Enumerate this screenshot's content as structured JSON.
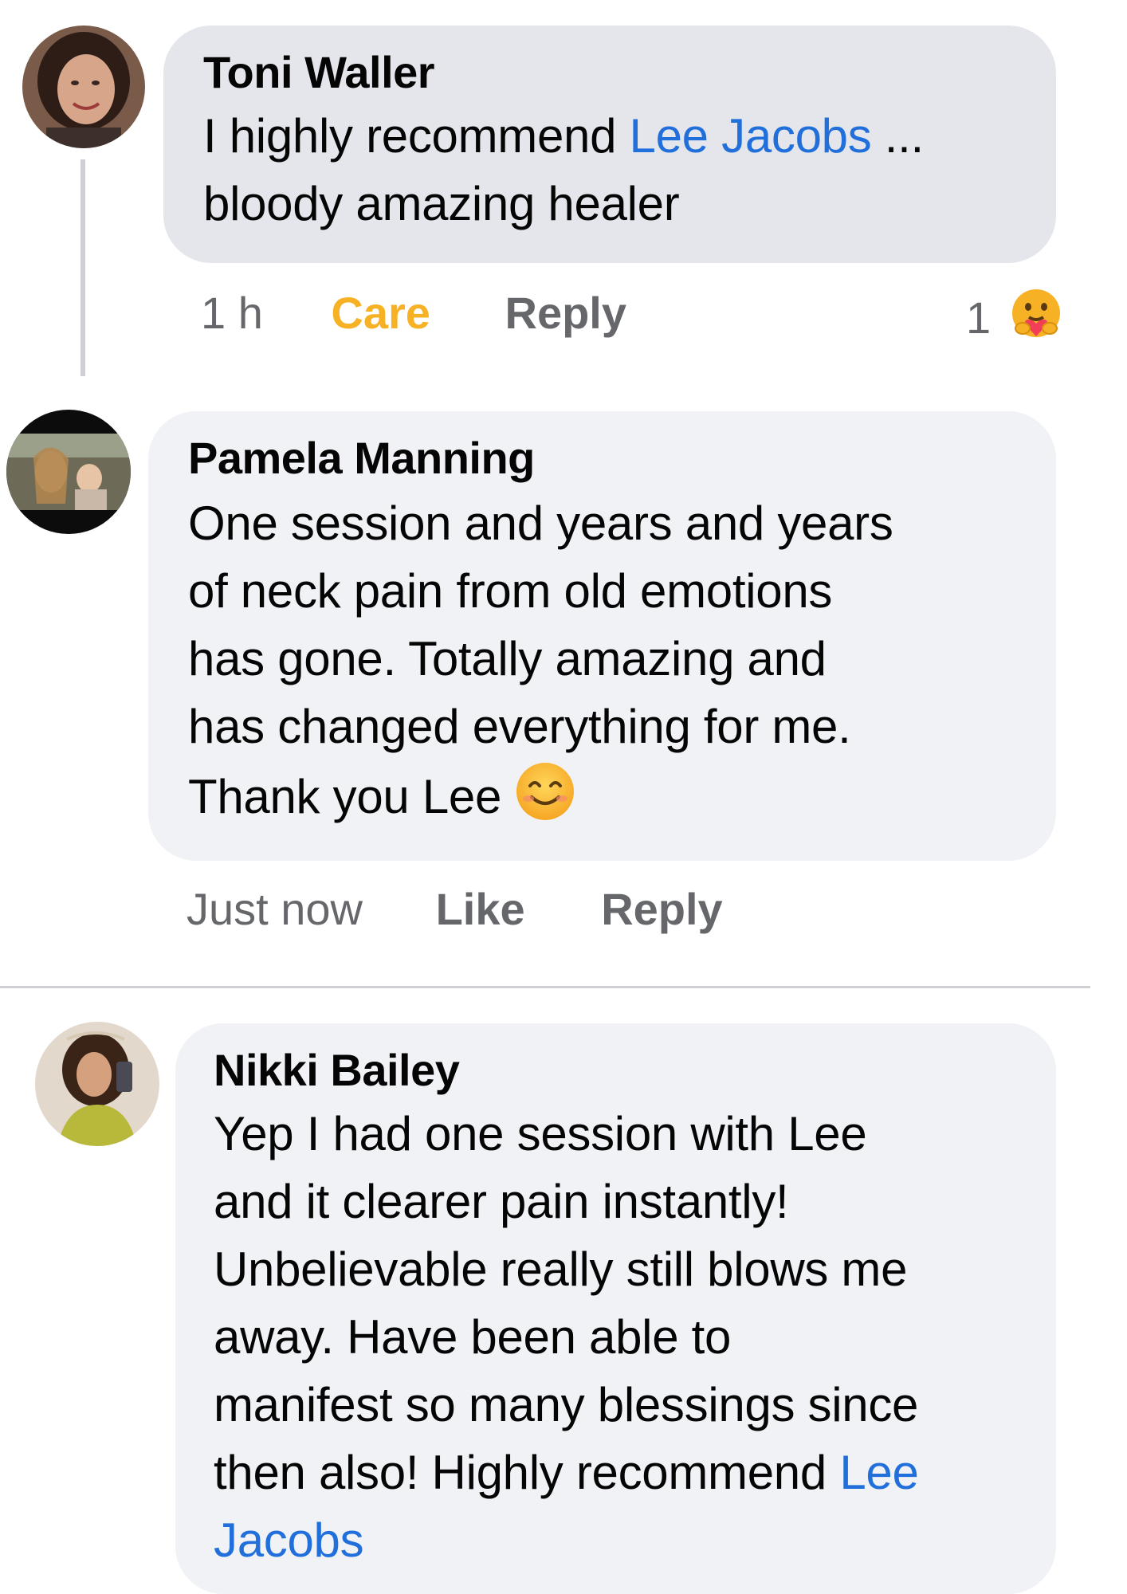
{
  "comments": [
    {
      "author": "Toni Waller",
      "text_before": "I highly recommend ",
      "link": "Lee Jacobs",
      "text_after": " ...",
      "text_line2": "bloody amazing healer",
      "time": "1 h",
      "reaction_label": "Care",
      "reply_label": "Reply",
      "reaction_count": "1",
      "reaction_icon": "care-hug-emoji",
      "reaction_color": "#f7b125"
    },
    {
      "author": "Pamela Manning",
      "lines": [
        "One session and years and years",
        "of neck pain from old emotions",
        "has gone. Totally amazing and",
        "has changed everything for me."
      ],
      "last_line": "Thank you Lee",
      "emoji": "smiling-face-emoji",
      "time": "Just now",
      "like_label": "Like",
      "reply_label": "Reply"
    },
    {
      "author": "Nikki Bailey",
      "lines": [
        "Yep I had one session with Lee",
        "and it clearer pain instantly!",
        "Unbelievable really still blows me",
        "away.  Have been able to",
        "manifest so many blessings since"
      ],
      "line6_text": "then also!  Highly recommend ",
      "line6_link": "Lee",
      "line7_link": "Jacobs"
    }
  ],
  "colors": {
    "bubble_highlight": "#e4e6eb",
    "bubble": "#f0f2f5",
    "link": "#216fdb",
    "meta": "#65676b",
    "care": "#f7b125"
  }
}
